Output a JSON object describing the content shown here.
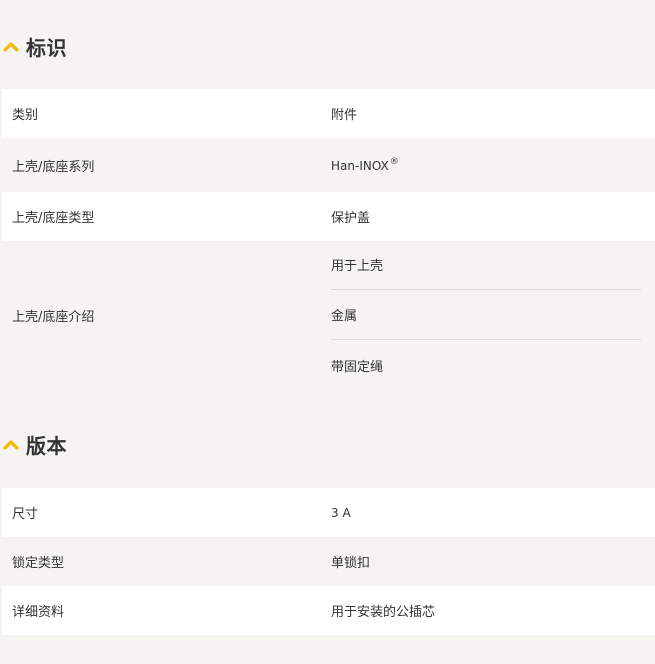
{
  "colors": {
    "accent": "#f5b800",
    "page_bg": "#f5f4f1",
    "row_white": "#ffffff",
    "row_grey": "#f5f4f1",
    "divider": "#dcdcdc",
    "text": "#333333"
  },
  "sections": [
    {
      "title": "标识",
      "icon": "chevron-up-icon",
      "rows": [
        {
          "label": "类别",
          "value": "附件"
        },
        {
          "label": "上壳/底座系列",
          "value": "Han-INOX",
          "value_sup": "®"
        },
        {
          "label": "上壳/底座类型",
          "value": "保护盖"
        },
        {
          "label": "上壳/底座介绍",
          "values": [
            "用于上壳",
            "金属",
            "带固定绳"
          ]
        }
      ]
    },
    {
      "title": "版本",
      "icon": "chevron-up-icon",
      "rows": [
        {
          "label": "尺寸",
          "value": "3 A"
        },
        {
          "label": "锁定类型",
          "value": "单锁扣"
        },
        {
          "label": "详细资料",
          "value": "用于安装的公插芯"
        }
      ]
    }
  ]
}
